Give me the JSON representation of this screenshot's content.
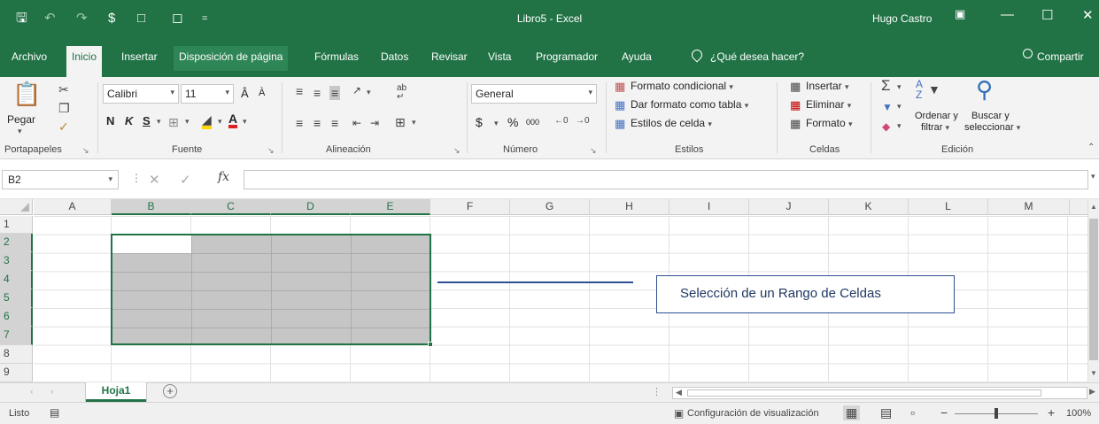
{
  "titlebar": {
    "title": "Libro5  -  Excel",
    "user": "Hugo Castro"
  },
  "tabs": [
    {
      "label": "Archivo"
    },
    {
      "label": "Inicio"
    },
    {
      "label": "Insertar"
    },
    {
      "label": "Disposición de página"
    },
    {
      "label": "Fórmulas"
    },
    {
      "label": "Datos"
    },
    {
      "label": "Revisar"
    },
    {
      "label": "Vista"
    },
    {
      "label": "Programador"
    },
    {
      "label": "Ayuda"
    }
  ],
  "tell_me": "¿Qué desea hacer?",
  "share": "Compartir",
  "ribbon": {
    "clipboard": {
      "paste": "Pegar",
      "label": "Portapapeles"
    },
    "font": {
      "name": "Calibri",
      "size": "11",
      "bold": "N",
      "italic": "K",
      "underline": "S",
      "label": "Fuente"
    },
    "alignment": {
      "label": "Alineación"
    },
    "number": {
      "format": "General",
      "currency": "$",
      "percent": "%",
      "thousands": "000",
      "label": "Número"
    },
    "styles": {
      "conditional": "Formato condicional",
      "as_table": "Dar formato como tabla",
      "cell_styles": "Estilos de celda",
      "label": "Estilos"
    },
    "cells": {
      "insert": "Insertar",
      "delete": "Eliminar",
      "format": "Formato",
      "label": "Celdas"
    },
    "editing": {
      "sort_line1": "Ordenar y",
      "sort_line2": "filtrar",
      "find_line1": "Buscar y",
      "find_line2": "seleccionar",
      "label": "Edición"
    }
  },
  "formula_bar": {
    "name_box": "B2",
    "fx": "fx",
    "value": ""
  },
  "columns": [
    "A",
    "B",
    "C",
    "D",
    "E",
    "F",
    "G",
    "H",
    "I",
    "J",
    "K",
    "L",
    "M"
  ],
  "rows": [
    "1",
    "2",
    "3",
    "4",
    "5",
    "6",
    "7",
    "8",
    "9"
  ],
  "callout": "Selección de un Rango de Celdas",
  "sheets": [
    {
      "name": "Hoja1"
    }
  ],
  "statusbar": {
    "status": "Listo",
    "display_settings": "Configuración de visualización",
    "zoom": "100%"
  }
}
